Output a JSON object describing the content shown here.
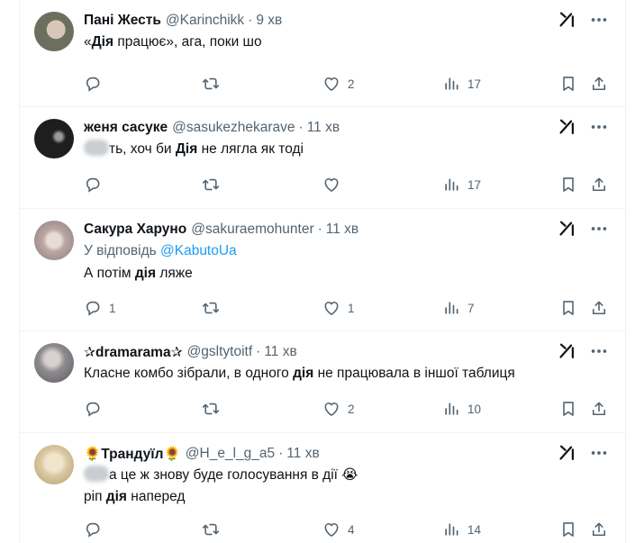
{
  "tweets": [
    {
      "name": "Пані Жесть",
      "handle": "@Karinchikk",
      "time": "9 хв",
      "text_pre": "«",
      "text_bold": "Дія",
      "text_post": " працює», ага, поки шо",
      "replies": "",
      "retweets": "",
      "likes": "2",
      "views": "17",
      "avatar_color": "#6b6f5e"
    },
    {
      "name": "женя сасуке",
      "handle": "@sasukezhekarave",
      "time": "11 хв",
      "text_pre": "ть, хоч би ",
      "text_bold": "Дія",
      "text_post": " не лягла як тоді",
      "replies": "",
      "retweets": "",
      "likes": "",
      "views": "17",
      "avatar_color": "#1e1e1e"
    },
    {
      "name": "Сакура Харуно",
      "handle": "@sakuraemohunter",
      "time": "11 хв",
      "reply_label": "У відповідь",
      "reply_handle": "@KabutoUa",
      "text_pre": "А потім ",
      "text_bold": "дія",
      "text_post": " ляже",
      "replies": "1",
      "retweets": "",
      "likes": "1",
      "views": "7",
      "avatar_color": "#b9a7a0"
    },
    {
      "name": "✰dramarama✰",
      "handle": "@gsltytoitf",
      "time": "11 хв",
      "text_pre": "Класне комбо зібрали, в одного ",
      "text_bold": "дія",
      "text_post": " не працювала в іншої таблиця",
      "replies": "",
      "retweets": "",
      "likes": "2",
      "views": "10",
      "avatar_color": "#8e8b8f"
    },
    {
      "name": "🌻Трандуїл🌻",
      "handle": "@H_e_l_g_a5",
      "time": "11 хв",
      "text_line1_post": "а це ж знову буде голосування в дії 😭",
      "text_pre": "ріп ",
      "text_bold": "дія",
      "text_post": " наперед",
      "replies": "",
      "retweets": "",
      "likes": "4",
      "views": "14",
      "avatar_color": "#d9c9a3"
    }
  ],
  "icons": {
    "reply": "reply-icon",
    "retweet": "retweet-icon",
    "like": "like-icon",
    "views": "views-icon",
    "bookmark": "bookmark-icon",
    "share": "share-icon",
    "grok": "grok-icon",
    "more": "more-icon"
  },
  "colors": {
    "text": "#0f1419",
    "secondary": "#536471",
    "link": "#1d9bf0",
    "border": "#eff3f4"
  }
}
